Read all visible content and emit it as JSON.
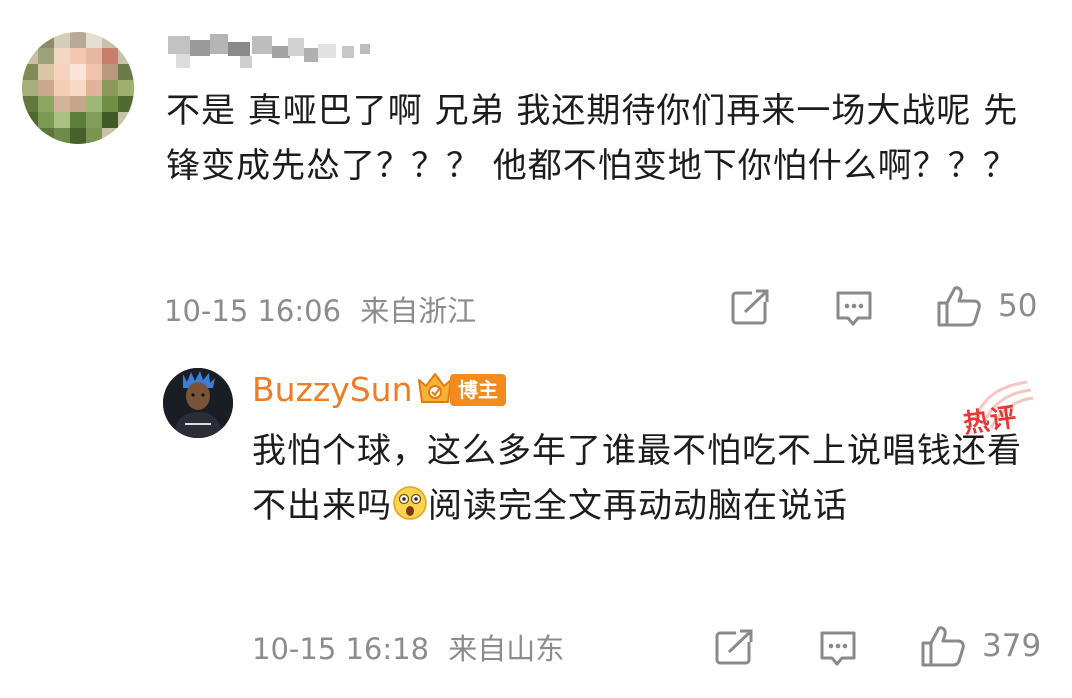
{
  "comment": {
    "text": "不是 真哑巴了啊 兄弟 我还期待你们再来一场大战呢 先锋变成先怂了？？？ 他都不怕变地下你怕什么啊？？？",
    "timestamp": "10-15 16:06",
    "location": "来自浙江",
    "like_count": "50"
  },
  "reply": {
    "username": "BuzzySun",
    "badge_label": "博主",
    "hot_label": "热评",
    "text_before": "我怕个球，这么多年了谁最不怕吃不上说唱钱还看不出来吗",
    "emoji": "astonished-emoji",
    "text_after": "阅读完全文再动动脑在说话",
    "timestamp": "10-15 16:18",
    "location": "来自山东",
    "like_count": "379"
  },
  "colors": {
    "username": "#f07d24",
    "badge": "#f38a1e",
    "hot": "#e53935",
    "meta": "#8c8c8c",
    "text": "#1c1c1c"
  },
  "icons": [
    "share-icon",
    "comment-icon",
    "like-icon"
  ]
}
